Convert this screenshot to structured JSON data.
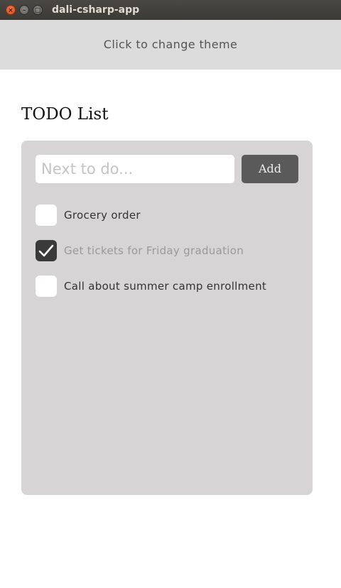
{
  "window": {
    "title": "dali-csharp-app",
    "close_glyph": "×",
    "minimize_glyph": "–",
    "maximize_glyph": "□"
  },
  "theme_bar": {
    "label": "Click to change theme"
  },
  "page": {
    "heading": "TODO List"
  },
  "input": {
    "placeholder": "Next to do...",
    "value": ""
  },
  "add_button": {
    "label": "Add"
  },
  "todos": [
    {
      "label": "Grocery order",
      "checked": false
    },
    {
      "label": "Get tickets for Friday graduation",
      "checked": true
    },
    {
      "label": "Call about summer camp enrollment",
      "checked": false
    }
  ],
  "colors": {
    "panel": "#d6d4d5",
    "theme_bar": "#dcdcdc",
    "button": "#5a5a5a",
    "checked_box": "#3a3a3a"
  }
}
